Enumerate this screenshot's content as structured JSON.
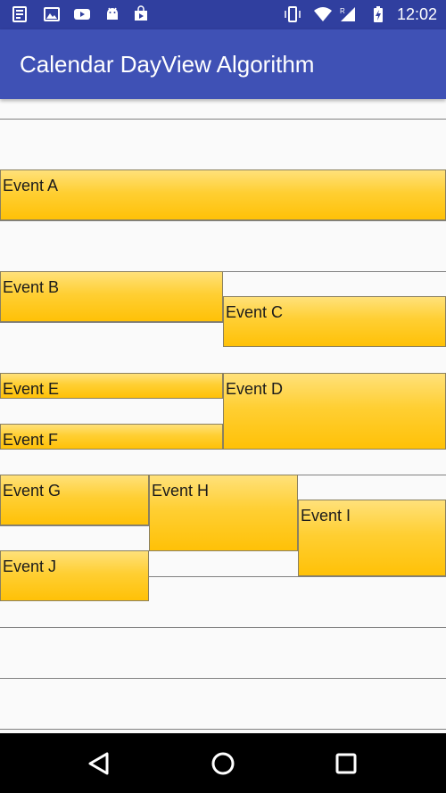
{
  "status_bar": {
    "time": "12:02",
    "icons": [
      "news-icon",
      "image-icon",
      "youtube-icon",
      "android-icon",
      "play-store-icon",
      "vibrate-icon",
      "wifi-icon",
      "signal-icon",
      "battery-charging-icon"
    ],
    "network_label": "R"
  },
  "app_bar": {
    "title": "Calendar DayView Algorithm",
    "color": "#3f51b5",
    "status_color": "#303f9f"
  },
  "day_view": {
    "event_color": "#ffc107",
    "events": [
      {
        "id": "a",
        "label": "Event A"
      },
      {
        "id": "b",
        "label": "Event B"
      },
      {
        "id": "c",
        "label": "Event C"
      },
      {
        "id": "d",
        "label": "Event D"
      },
      {
        "id": "e",
        "label": "Event E"
      },
      {
        "id": "f",
        "label": "Event F"
      },
      {
        "id": "g",
        "label": "Event G"
      },
      {
        "id": "h",
        "label": "Event H"
      },
      {
        "id": "i",
        "label": "Event I"
      },
      {
        "id": "j",
        "label": "Event J"
      }
    ]
  },
  "nav_bar": {
    "buttons": [
      "back-icon",
      "home-icon",
      "recents-icon"
    ]
  }
}
